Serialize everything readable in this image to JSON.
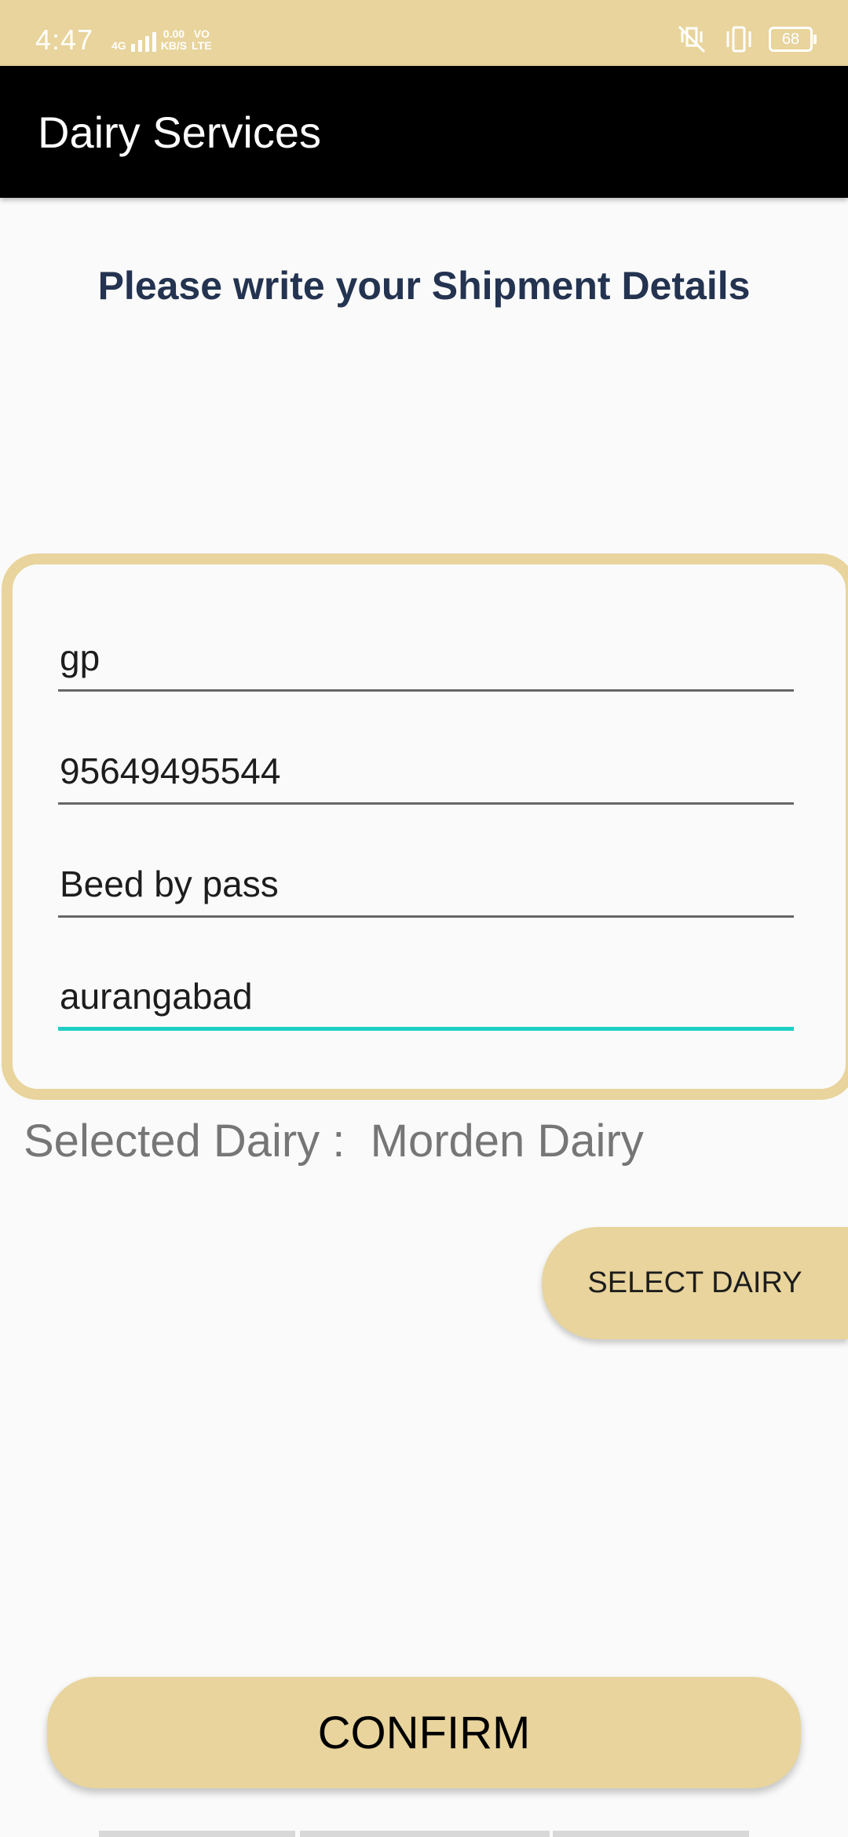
{
  "status_bar": {
    "time": "4:47",
    "network_type": "4G",
    "data_speed": "0.00",
    "data_unit": "KB/S",
    "volte_top": "VO",
    "volte_bottom": "LTE",
    "battery": "68",
    "icons": [
      "signal-icon",
      "mute-vibrate-icon",
      "vibrate-icon",
      "battery-icon"
    ],
    "color": "#e8d49c"
  },
  "app_bar": {
    "title": "Dairy Services",
    "color": "#000000"
  },
  "page": {
    "heading": "Please write your Shipment Details"
  },
  "form": {
    "fields": [
      {
        "value": "gp"
      },
      {
        "value": "95649495544"
      },
      {
        "value": "Beed by pass"
      },
      {
        "value": "aurangabad",
        "focused": true
      }
    ],
    "border_color": "#e8d49c",
    "focus_color": "#1dcfc3"
  },
  "selection": {
    "label": "Selected Dairy :",
    "value": "Morden Dairy"
  },
  "actions": {
    "select_dairy": "SELECT DAIRY",
    "confirm": "CONFIRM"
  }
}
